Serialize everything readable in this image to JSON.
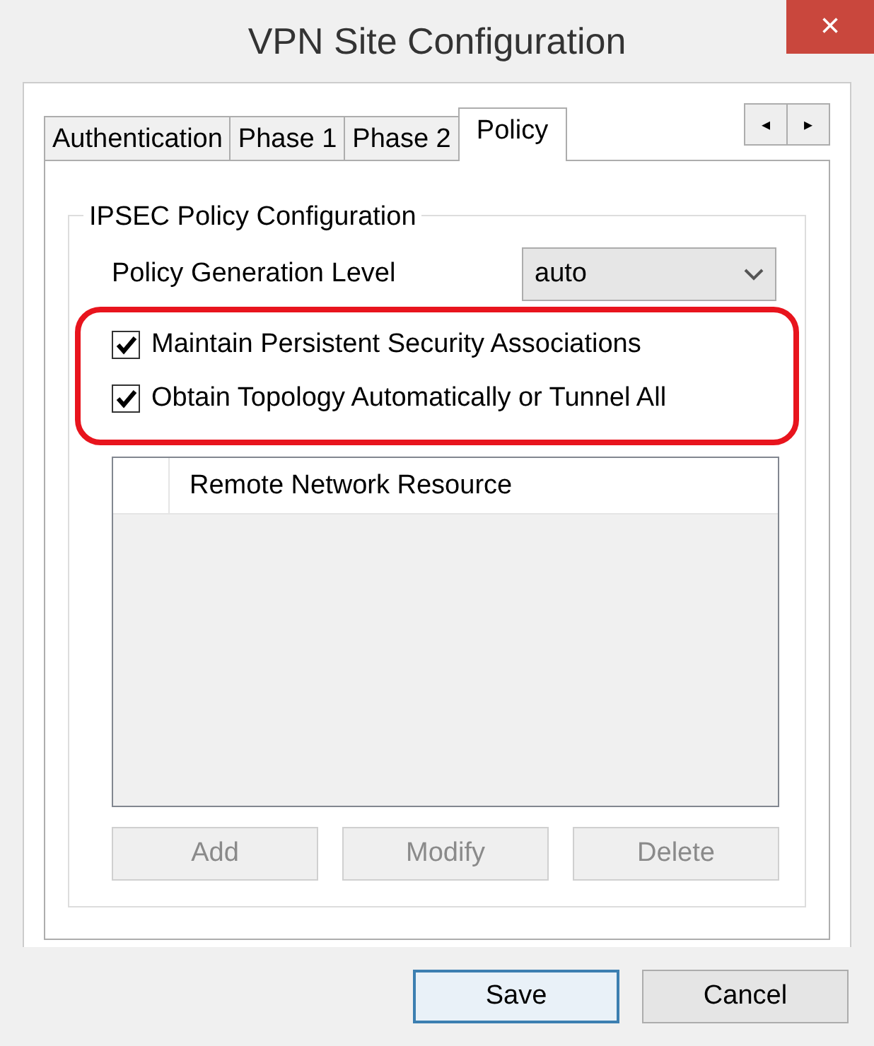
{
  "window": {
    "title": "VPN Site Configuration",
    "close": "×"
  },
  "tabs": [
    {
      "label": "Authentication",
      "selected": false
    },
    {
      "label": "Phase 1",
      "selected": false
    },
    {
      "label": "Phase 2",
      "selected": false
    },
    {
      "label": "Policy",
      "selected": true
    }
  ],
  "tab_scroll": {
    "left": "◂",
    "right": "▸"
  },
  "group": {
    "title": "IPSEC Policy Configuration",
    "level_label": "Policy Generation Level",
    "level_value": "auto",
    "options_highlighted": true,
    "options": [
      {
        "label": "Maintain Persistent Security Associations",
        "checked": true
      },
      {
        "label": "Obtain Topology Automatically or Tunnel All",
        "checked": true
      }
    ],
    "table": {
      "columns": [
        "Remote Network Resource"
      ]
    },
    "buttons": [
      {
        "label": "Add",
        "disabled": true
      },
      {
        "label": "Modify",
        "disabled": true
      },
      {
        "label": "Delete",
        "disabled": true
      }
    ]
  },
  "buttons": [
    {
      "label": "Save",
      "default": true
    },
    {
      "label": "Cancel",
      "default": false
    }
  ]
}
